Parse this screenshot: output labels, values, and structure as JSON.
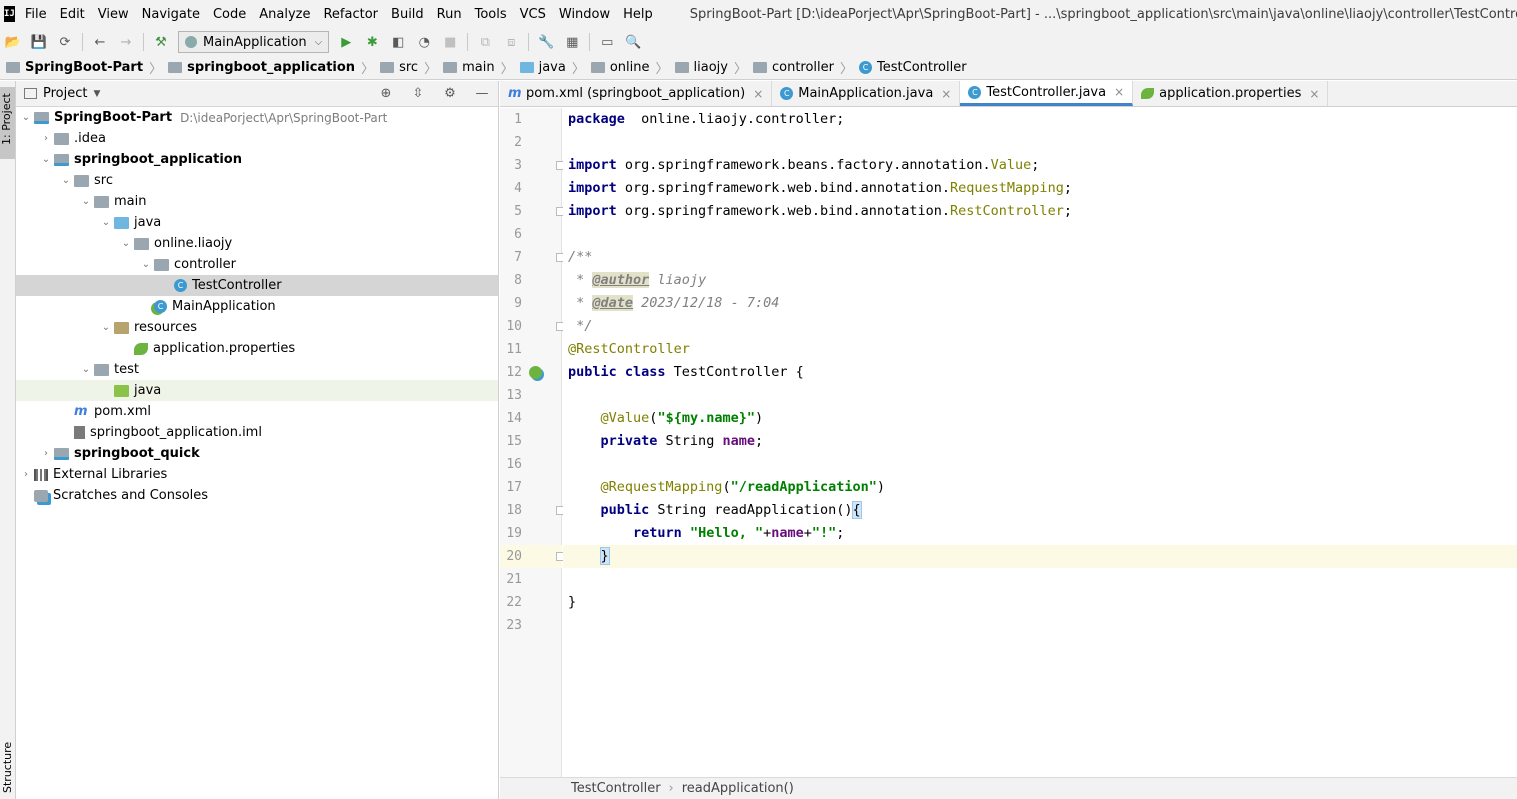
{
  "menubar": {
    "logo": "IJ",
    "items": [
      "File",
      "Edit",
      "View",
      "Navigate",
      "Code",
      "Analyze",
      "Refactor",
      "Build",
      "Run",
      "Tools",
      "VCS",
      "Window",
      "Help"
    ],
    "window_title": "SpringBoot-Part [D:\\ideaPorject\\Apr\\SpringBoot-Part] - ...\\springboot_application\\src\\main\\java\\online\\liaojy\\controller\\TestController.java [springboot_application]"
  },
  "toolbar": {
    "run_config": "MainApplication"
  },
  "breadcrumb": [
    {
      "label": "SpringBoot-Part",
      "icon": "module-icon",
      "bold": true
    },
    {
      "label": "springboot_application",
      "icon": "module-icon",
      "bold": true
    },
    {
      "label": "src",
      "icon": "folder-icon"
    },
    {
      "label": "main",
      "icon": "folder-icon"
    },
    {
      "label": "java",
      "icon": "source-folder-icon"
    },
    {
      "label": "online",
      "icon": "package-icon"
    },
    {
      "label": "liaojy",
      "icon": "package-icon"
    },
    {
      "label": "controller",
      "icon": "package-icon"
    },
    {
      "label": "TestController",
      "icon": "class-icon"
    }
  ],
  "left_strip": {
    "project_tab": "1: Project",
    "structure_tab": "Structure"
  },
  "project_panel": {
    "title": "Project",
    "tree": [
      {
        "label": "SpringBoot-Part",
        "sub": "D:\\ideaPorject\\Apr\\SpringBoot-Part",
        "depth": 0,
        "arrow": "open",
        "icon": "module",
        "bold": true
      },
      {
        "label": ".idea",
        "depth": 1,
        "arrow": "closed",
        "icon": "folder"
      },
      {
        "label": "springboot_application",
        "depth": 1,
        "arrow": "open",
        "icon": "module",
        "bold": true
      },
      {
        "label": "src",
        "depth": 2,
        "arrow": "open",
        "icon": "folder"
      },
      {
        "label": "main",
        "depth": 3,
        "arrow": "open",
        "icon": "folder"
      },
      {
        "label": "java",
        "depth": 4,
        "arrow": "open",
        "icon": "folder-blue"
      },
      {
        "label": "online.liaojy",
        "depth": 5,
        "arrow": "open",
        "icon": "folder"
      },
      {
        "label": "controller",
        "depth": 6,
        "arrow": "open",
        "icon": "folder"
      },
      {
        "label": "TestController",
        "depth": 7,
        "arrow": "none",
        "icon": "cls",
        "selected": true
      },
      {
        "label": "MainApplication",
        "depth": 6,
        "arrow": "none",
        "icon": "cls-spring"
      },
      {
        "label": "resources",
        "depth": 4,
        "arrow": "open",
        "icon": "folder-res"
      },
      {
        "label": "application.properties",
        "depth": 5,
        "arrow": "none",
        "icon": "leaf"
      },
      {
        "label": "test",
        "depth": 3,
        "arrow": "open",
        "icon": "folder"
      },
      {
        "label": "java",
        "depth": 4,
        "arrow": "none",
        "icon": "folder-green",
        "highlight": true
      },
      {
        "label": "pom.xml",
        "depth": 2,
        "arrow": "none",
        "icon": "maven"
      },
      {
        "label": "springboot_application.iml",
        "depth": 2,
        "arrow": "none",
        "icon": "file"
      },
      {
        "label": "springboot_quick",
        "depth": 1,
        "arrow": "closed",
        "icon": "module",
        "bold": true
      },
      {
        "label": "External Libraries",
        "depth": 0,
        "arrow": "closed",
        "icon": "libs"
      },
      {
        "label": "Scratches and Consoles",
        "depth": 0,
        "arrow": "none",
        "icon": "scratch"
      }
    ]
  },
  "editor_tabs": [
    {
      "label": "pom.xml (springboot_application)",
      "icon": "maven",
      "active": false
    },
    {
      "label": "MainApplication.java",
      "icon": "cls",
      "active": false
    },
    {
      "label": "TestController.java",
      "icon": "cls",
      "active": true
    },
    {
      "label": "application.properties",
      "icon": "leaf",
      "active": false
    }
  ],
  "editor": {
    "current_line": 20,
    "lines": [
      [
        [
          "kw",
          "package"
        ],
        [
          "",
          "  online.liaojy.controller;"
        ]
      ],
      [],
      [
        [
          "kw",
          "import"
        ],
        [
          "",
          " org.springframework.beans.factory.annotation."
        ],
        [
          "yl",
          "Value"
        ],
        [
          "",
          ";"
        ]
      ],
      [
        [
          "kw",
          "import"
        ],
        [
          "",
          " org.springframework.web.bind.annotation."
        ],
        [
          "yl",
          "RequestMapping"
        ],
        [
          "",
          ";"
        ]
      ],
      [
        [
          "kw",
          "import"
        ],
        [
          "",
          " org.springframework.web.bind.annotation."
        ],
        [
          "yl",
          "RestController"
        ],
        [
          "",
          ";"
        ]
      ],
      [],
      [
        [
          "cm",
          "/**"
        ]
      ],
      [
        [
          "cm",
          " * "
        ],
        [
          "tag",
          "@author"
        ],
        [
          "cm",
          " liaojy"
        ]
      ],
      [
        [
          "cm",
          " * "
        ],
        [
          "tag",
          "@date"
        ],
        [
          "cm",
          " 2023/12/18 - 7:04"
        ]
      ],
      [
        [
          "cm",
          " */"
        ]
      ],
      [
        [
          "ann",
          "@RestController"
        ]
      ],
      [
        [
          "kw",
          "public class"
        ],
        [
          "",
          " TestController {"
        ]
      ],
      [],
      [
        [
          "",
          "    "
        ],
        [
          "ann",
          "@Value"
        ],
        [
          "",
          "("
        ],
        [
          "str",
          "\"${my.name}\""
        ],
        [
          "",
          ")"
        ]
      ],
      [
        [
          "",
          "    "
        ],
        [
          "kw",
          "private"
        ],
        [
          "",
          " String "
        ],
        [
          "fld",
          "name"
        ],
        [
          "",
          ";"
        ]
      ],
      [],
      [
        [
          "",
          "    "
        ],
        [
          "ann",
          "@RequestMapping"
        ],
        [
          "",
          "("
        ],
        [
          "str",
          "\"/readApplication\""
        ],
        [
          "",
          ")"
        ]
      ],
      [
        [
          "",
          "    "
        ],
        [
          "kw",
          "public"
        ],
        [
          "",
          " String readApplication()"
        ],
        [
          "bh",
          "{"
        ]
      ],
      [
        [
          "",
          "        "
        ],
        [
          "kw",
          "return"
        ],
        [
          "",
          " "
        ],
        [
          "str",
          "\"Hello, \""
        ],
        [
          "",
          "+"
        ],
        [
          "fld",
          "name"
        ],
        [
          "",
          "+"
        ],
        [
          "str",
          "\"!\""
        ],
        [
          "",
          ";"
        ]
      ],
      [
        [
          "",
          "    "
        ],
        [
          "bh",
          "}"
        ]
      ],
      [],
      [
        [
          "",
          "}"
        ]
      ],
      []
    ],
    "fold_lines": [
      3,
      5,
      7,
      10,
      18,
      20
    ],
    "bean_gutter_line": 12
  },
  "editor_crumbs": [
    "TestController",
    "readApplication()"
  ]
}
